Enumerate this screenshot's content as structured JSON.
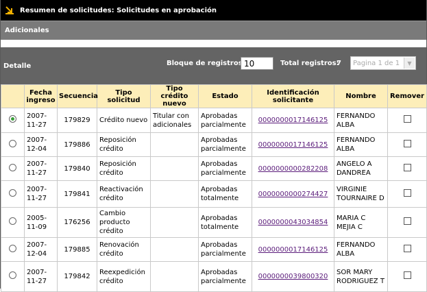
{
  "header": {
    "title": "Resumen de solicitudes: Solicitudes en aprobación"
  },
  "section": {
    "title": "Adicionales"
  },
  "toolbar": {
    "detail_label": "Detalle",
    "block_label": "Bloque de registros:",
    "block_value": "10",
    "total_label": "Total registros:",
    "total_value": "7",
    "page_select": "Pagina 1 de 1"
  },
  "table": {
    "columns": [
      "",
      "Fecha ingreso",
      "Secuencia",
      "Tipo solicitud",
      "Tipo crédito nuevo",
      "Estado",
      "Identificación solicitante",
      "Nombre",
      "Remover"
    ],
    "rows": [
      {
        "selected": true,
        "fecha": "2007-11-27",
        "secuencia": "179829",
        "tipo": "Crédito nuevo",
        "tipo_credito": "Titular con adicionales",
        "estado": "Aprobadas parcialmente",
        "id": "0000000017146125",
        "nombre": "FERNANDO ALBA"
      },
      {
        "selected": false,
        "fecha": "2007-12-04",
        "secuencia": "179886",
        "tipo": "Reposición crédito",
        "tipo_credito": "",
        "estado": "Aprobadas parcialmente",
        "id": "0000000017146125",
        "nombre": "FERNANDO ALBA"
      },
      {
        "selected": false,
        "fecha": "2007-11-27",
        "secuencia": "179840",
        "tipo": "Reposición crédito",
        "tipo_credito": "",
        "estado": "Aprobadas parcialmente",
        "id": "0000000000282208",
        "nombre": "ANGELO A DANDREA"
      },
      {
        "selected": false,
        "fecha": "2007-11-27",
        "secuencia": "179841",
        "tipo": "Reactivación crédito",
        "tipo_credito": "",
        "estado": "Aprobadas totalmente",
        "id": "0000000000274427",
        "nombre": "VIRGINIE TOURNAIRE D"
      },
      {
        "selected": false,
        "fecha": "2005-11-09",
        "secuencia": "176256",
        "tipo": "Cambio producto crédito",
        "tipo_credito": "",
        "estado": "Aprobadas totalmente",
        "id": "0000000043034854",
        "nombre": "MARIA C MEJIA C"
      },
      {
        "selected": false,
        "fecha": "2007-12-04",
        "secuencia": "179885",
        "tipo": "Renovación crédito",
        "tipo_credito": "",
        "estado": "Aprobadas parcialmente",
        "id": "0000000017146125",
        "nombre": "FERNANDO ALBA"
      },
      {
        "selected": false,
        "fecha": "2007-11-27",
        "secuencia": "179842",
        "tipo": "Reexpedición crédito",
        "tipo_credito": "",
        "estado": "Aprobadas parcialmente",
        "id": "0000000039800320",
        "nombre": "SOR MARY RODRIGUEZ T"
      }
    ]
  }
}
